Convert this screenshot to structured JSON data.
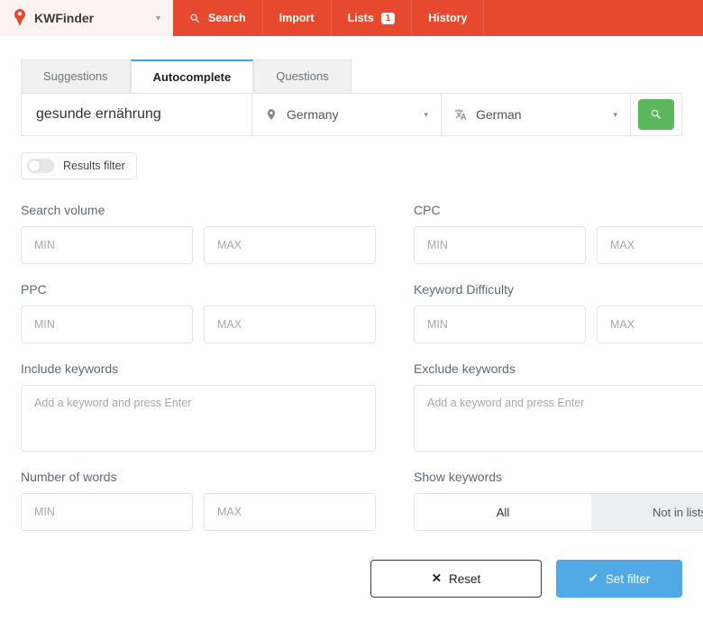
{
  "brand": {
    "name": "KWFinder"
  },
  "nav": {
    "search": "Search",
    "import": "Import",
    "lists": "Lists",
    "lists_badge": "1",
    "history": "History"
  },
  "tabs": {
    "suggestions": "Suggestions",
    "autocomplete": "Autocomplete",
    "questions": "Questions"
  },
  "search": {
    "keyword_value": "gesunde ernährung",
    "location": "Germany",
    "language": "German"
  },
  "filter": {
    "toggle_label": "Results filter",
    "search_volume": {
      "label": "Search volume",
      "min": "MIN",
      "max": "MAX"
    },
    "cpc": {
      "label": "CPC",
      "min": "MIN",
      "max": "MAX"
    },
    "ppc": {
      "label": "PPC",
      "min": "MIN",
      "max": "MAX"
    },
    "kd": {
      "label": "Keyword Difficulty",
      "min": "MIN",
      "max": "MAX"
    },
    "include": {
      "label": "Include keywords",
      "placeholder": "Add a keyword and press Enter"
    },
    "exclude": {
      "label": "Exclude keywords",
      "placeholder": "Add a keyword and press Enter"
    },
    "words": {
      "label": "Number of words",
      "min": "MIN",
      "max": "MAX"
    },
    "show": {
      "label": "Show keywords",
      "all": "All",
      "not_in_lists": "Not in lists"
    },
    "reset": "Reset",
    "set": "Set filter"
  }
}
